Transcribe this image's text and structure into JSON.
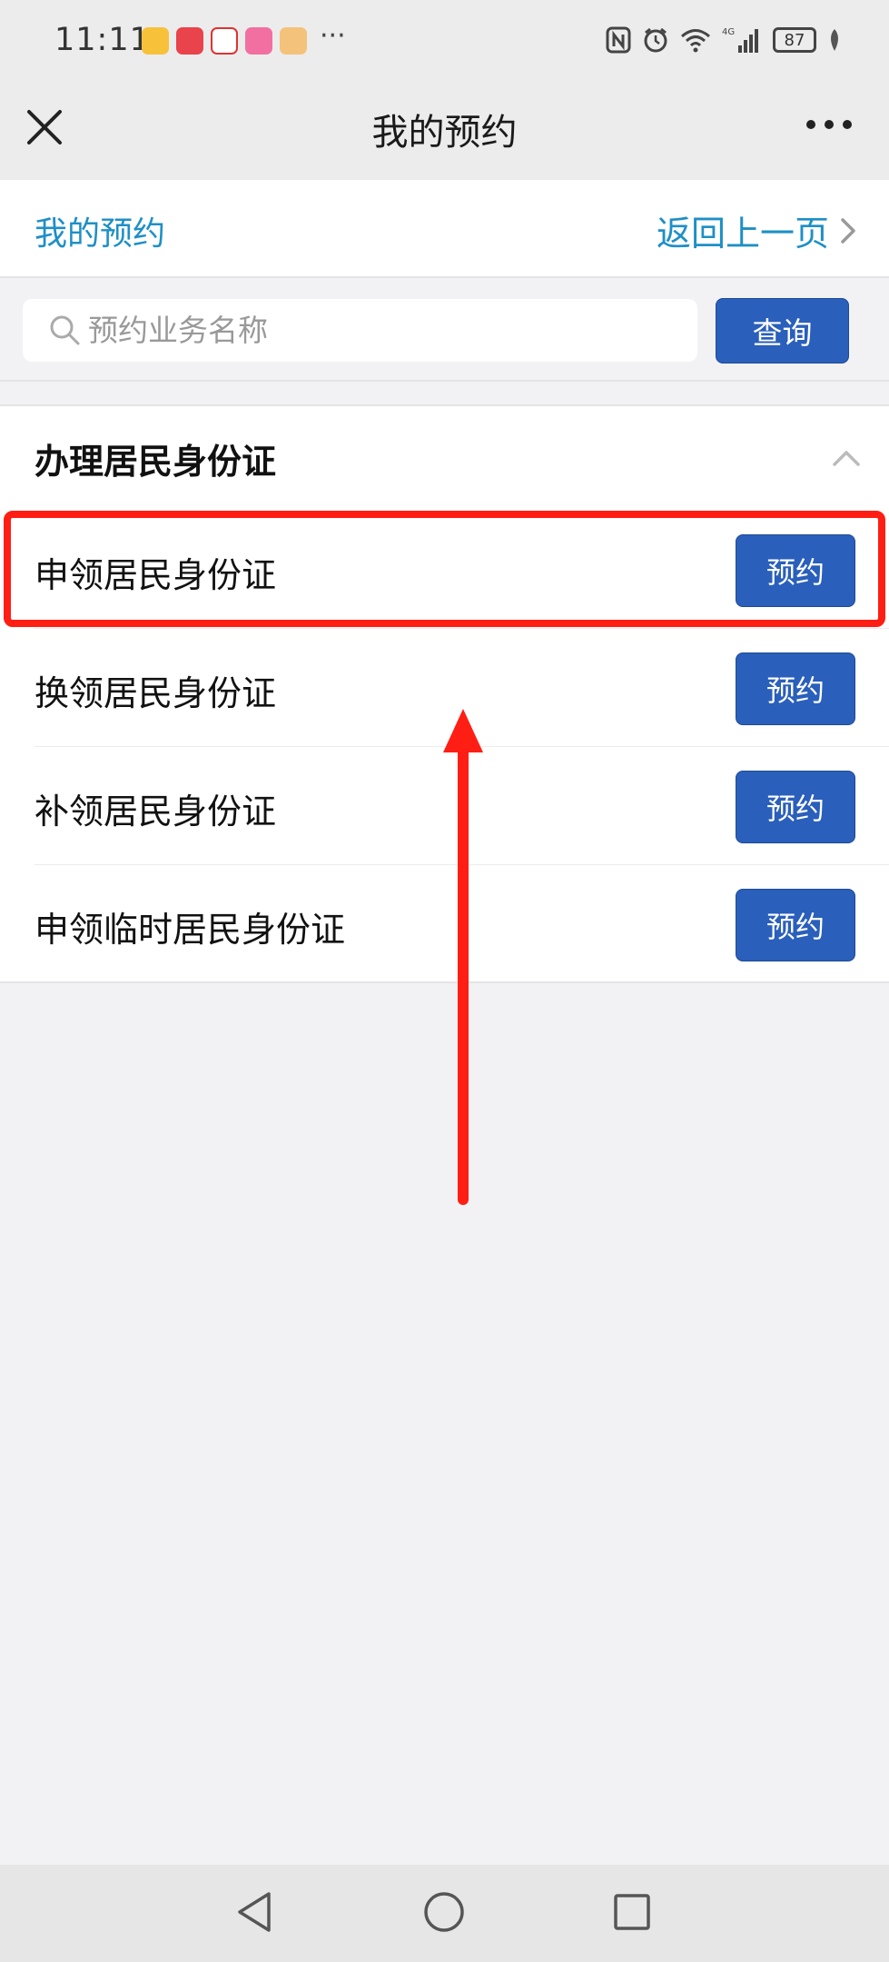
{
  "status_bar": {
    "time": "11:11",
    "overflow": "···",
    "battery": "87",
    "network": "4G",
    "app_icons": [
      "weibo-icon",
      "huawei-mall-icon",
      "jd-icon",
      "pink-app-icon",
      "cartoon-app-icon"
    ]
  },
  "title_bar": {
    "title": "我的预约"
  },
  "sub_header": {
    "title": "我的预约",
    "back_label": "返回上一页"
  },
  "search": {
    "placeholder": "预约业务名称",
    "value": "",
    "button_label": "查询"
  },
  "section": {
    "title": "办理居民身份证",
    "items": [
      {
        "label": "申领居民身份证",
        "button": "预约"
      },
      {
        "label": "换领居民身份证",
        "button": "预约"
      },
      {
        "label": "补领居民身份证",
        "button": "预约"
      },
      {
        "label": "申领临时居民身份证",
        "button": "预约"
      }
    ]
  },
  "colors": {
    "accent_text": "#1e8fc6",
    "button_blue": "#2a5fbb",
    "annotation_red": "#ff1e14"
  }
}
